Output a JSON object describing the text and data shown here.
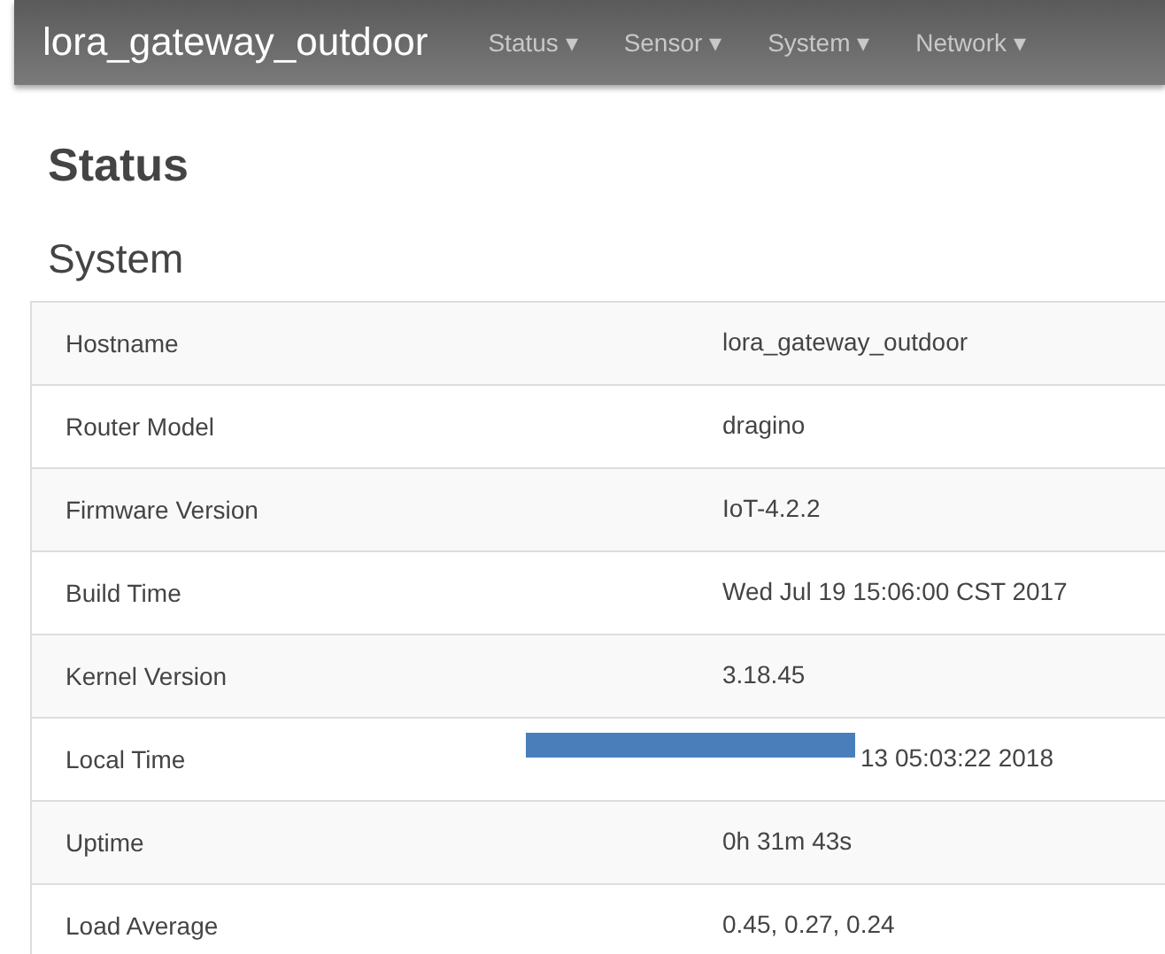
{
  "navbar": {
    "brand": "lora_gateway_outdoor",
    "menus": [
      {
        "label": "Status",
        "caret": "▾"
      },
      {
        "label": "Sensor",
        "caret": "▾"
      },
      {
        "label": "System",
        "caret": "▾"
      },
      {
        "label": "Network",
        "caret": "▾"
      }
    ]
  },
  "page_title": "Status",
  "section_title": "System",
  "rows": [
    {
      "label": "Hostname",
      "value": "lora_gateway_outdoor"
    },
    {
      "label": "Router Model",
      "value": "dragino"
    },
    {
      "label": "Firmware Version",
      "value": "IoT-4.2.2"
    },
    {
      "label": "Build Time",
      "value": "Wed Jul 19 15:06:00 CST 2017"
    },
    {
      "label": "Kernel Version",
      "value": "3.18.45"
    },
    {
      "label": "Local Time",
      "value": "13 05:03:22 2018",
      "redacted": true
    },
    {
      "label": "Uptime",
      "value": "0h 31m 43s"
    },
    {
      "label": "Load Average",
      "value": "0.45, 0.27, 0.24"
    }
  ]
}
